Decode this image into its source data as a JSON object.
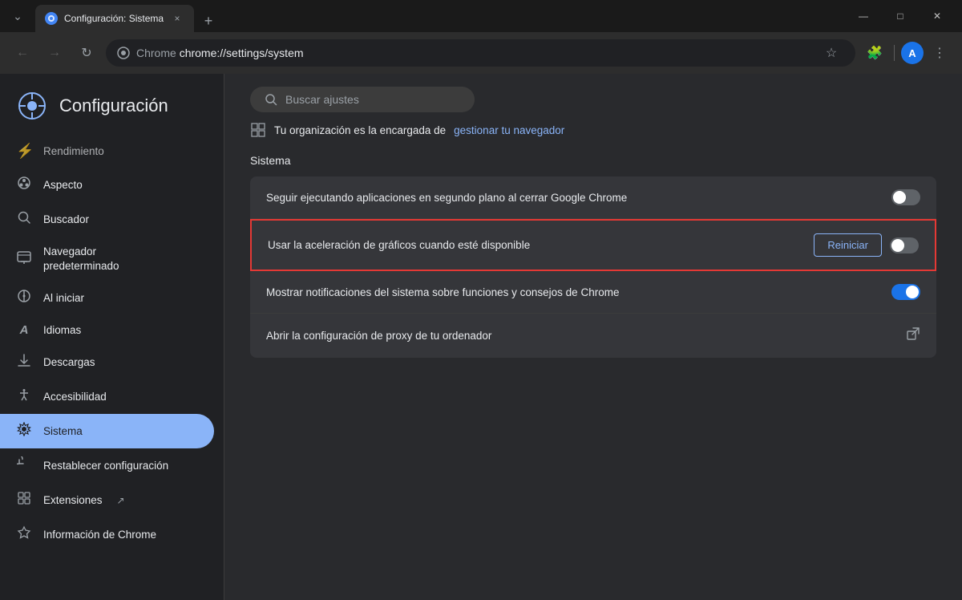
{
  "titleBar": {
    "tab": {
      "favicon": "⚙",
      "title": "Configuración: Sistema",
      "closeLabel": "×"
    },
    "newTabLabel": "+",
    "windowControls": {
      "minimize": "—",
      "maximize": "□",
      "close": "✕"
    }
  },
  "addressBar": {
    "backLabel": "←",
    "forwardLabel": "→",
    "reloadLabel": "↻",
    "brandName": "Chrome",
    "urlProtocol": "chrome://",
    "urlPath": "settings/system",
    "urlFull": "chrome://settings/system",
    "starLabel": "☆",
    "extensionsLabel": "🧩",
    "menuLabel": "⋮",
    "avatarLabel": "A"
  },
  "sidebar": {
    "logoLabel": "⚙",
    "settingsTitle": "Configuración",
    "items": [
      {
        "id": "rendimiento",
        "icon": "⚡",
        "label": "Rendimiento"
      },
      {
        "id": "aspecto",
        "icon": "🎨",
        "label": "Aspecto"
      },
      {
        "id": "buscador",
        "icon": "🔍",
        "label": "Buscador"
      },
      {
        "id": "navegador",
        "icon": "💻",
        "label": "Navegador predeterminado"
      },
      {
        "id": "al-iniciar",
        "icon": "⏻",
        "label": "Al iniciar"
      },
      {
        "id": "idiomas",
        "icon": "A",
        "label": "Idiomas"
      },
      {
        "id": "descargas",
        "icon": "⬇",
        "label": "Descargas"
      },
      {
        "id": "accesibilidad",
        "icon": "♿",
        "label": "Accesibilidad"
      },
      {
        "id": "sistema",
        "icon": "⚙",
        "label": "Sistema",
        "active": true
      },
      {
        "id": "restablecer",
        "icon": "↺",
        "label": "Restablecer configuración"
      },
      {
        "id": "extensiones",
        "icon": "🧩",
        "label": "Extensiones",
        "hasExternal": true
      },
      {
        "id": "info-chrome",
        "icon": "🛡",
        "label": "Información de Chrome"
      }
    ]
  },
  "content": {
    "searchPlaceholder": "Buscar ajustes",
    "orgBanner": {
      "icon": "▦",
      "text": "Tu organización es la encargada de",
      "linkText": "gestionar tu navegador"
    },
    "sectionTitle": "Sistema",
    "settings": [
      {
        "id": "background-apps",
        "text": "Seguir ejecutando aplicaciones en segundo plano al cerrar Google Chrome",
        "toggleOn": false,
        "highlighted": false
      },
      {
        "id": "gpu-acceleration",
        "text": "Usar la aceleración de gráficos cuando esté disponible",
        "toggleOn": false,
        "highlighted": true,
        "hasReiniciar": true,
        "reiniciarLabel": "Reiniciar"
      },
      {
        "id": "system-notifications",
        "text": "Mostrar notificaciones del sistema sobre funciones y consejos de Chrome",
        "toggleOn": true,
        "highlighted": false
      },
      {
        "id": "proxy-settings",
        "text": "Abrir la configuración de proxy de tu ordenador",
        "toggleOn": null,
        "highlighted": false,
        "hasExternalLink": true
      }
    ]
  }
}
